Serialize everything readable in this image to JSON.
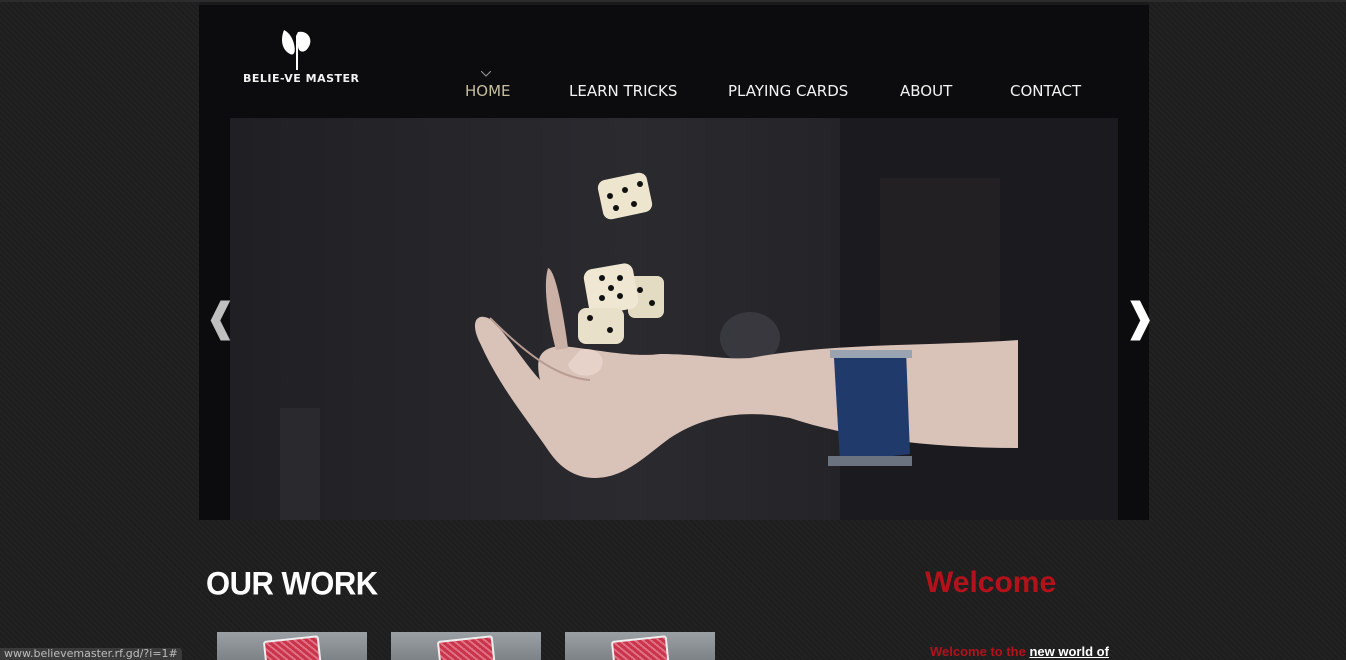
{
  "logo": {
    "text": "BELIE-VE MASTER",
    "icon": "believe-master-logo-icon"
  },
  "nav": {
    "items": [
      {
        "label": "HOME",
        "active": true
      },
      {
        "label": "LEARN TRICKS",
        "active": false
      },
      {
        "label": "PLAYING CARDS",
        "active": false
      },
      {
        "label": "ABOUT",
        "active": false
      },
      {
        "label": "CONTACT",
        "active": false
      }
    ]
  },
  "slider": {
    "prev_icon": "❰",
    "next_icon": "❱",
    "image": "hand-tossing-dice-image"
  },
  "sections": {
    "our_work_title": "OUR WORK",
    "welcome_title": "Welcome",
    "welcome_text_prefix": "Welcome to the ",
    "welcome_text_link": "new world of"
  },
  "status_bar": {
    "url": "www.believemaster.rf.gd/?i=1#"
  },
  "colors": {
    "accent_red": "#b3121a",
    "nav_active": "#c7bea0",
    "background": "#1e1e1e"
  }
}
